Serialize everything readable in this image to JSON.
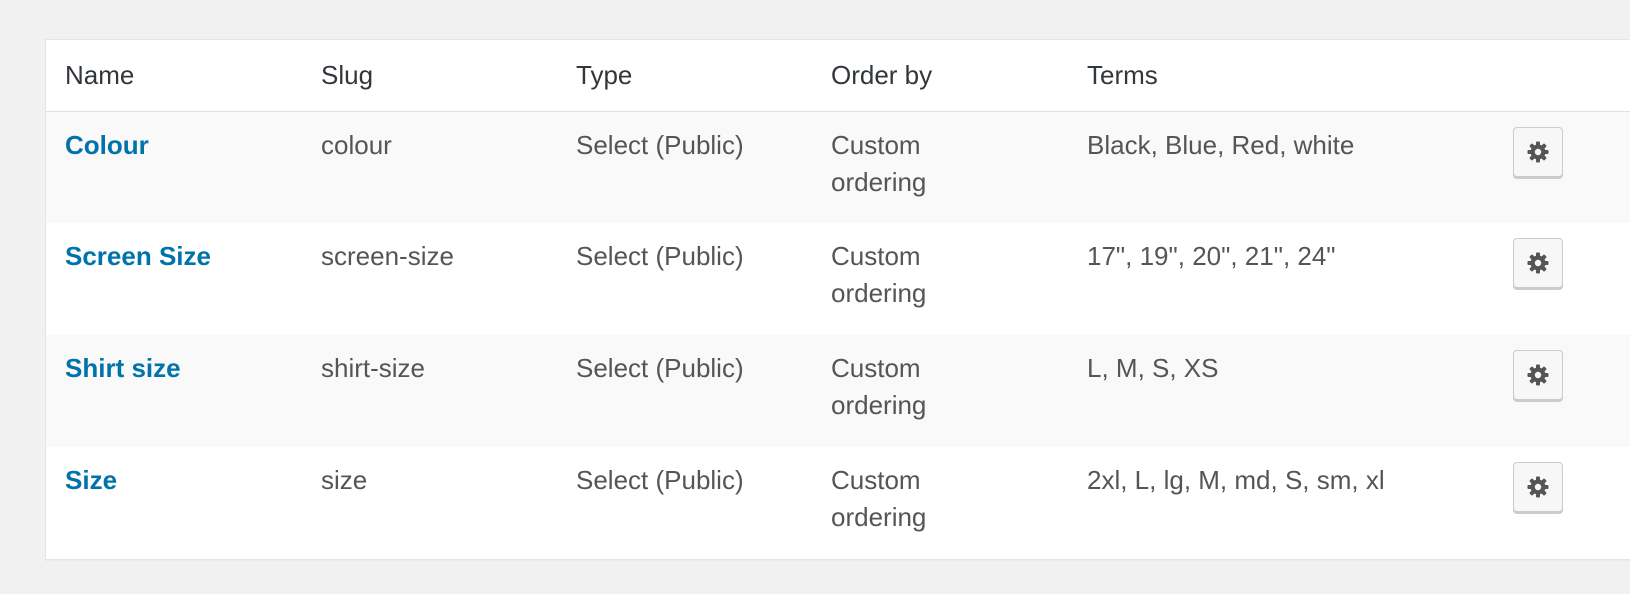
{
  "table": {
    "headers": {
      "name": "Name",
      "slug": "Slug",
      "type": "Type",
      "order_by": "Order by",
      "terms": "Terms"
    },
    "rows": [
      {
        "name": "Colour",
        "slug": "colour",
        "type": "Select (Public)",
        "order_by": "Custom ordering",
        "terms": "Black, Blue, Red, white"
      },
      {
        "name": "Screen Size",
        "slug": "screen-size",
        "type": "Select (Public)",
        "order_by": "Custom ordering",
        "terms": "17\", 19\", 20\", 21\", 24\""
      },
      {
        "name": "Shirt size",
        "slug": "shirt-size",
        "type": "Select (Public)",
        "order_by": "Custom ordering",
        "terms": "L, M, S, XS"
      },
      {
        "name": "Size",
        "slug": "size",
        "type": "Select (Public)",
        "order_by": "Custom ordering",
        "terms": "2xl, L, lg, M, md, S, sm, xl"
      }
    ],
    "action_icon": "gear-icon"
  },
  "colors": {
    "link": "#0073aa",
    "text": "#555555",
    "header_text": "#32373c",
    "page_background": "#f1f1f1",
    "alt_row_background": "#f9f9f9"
  }
}
